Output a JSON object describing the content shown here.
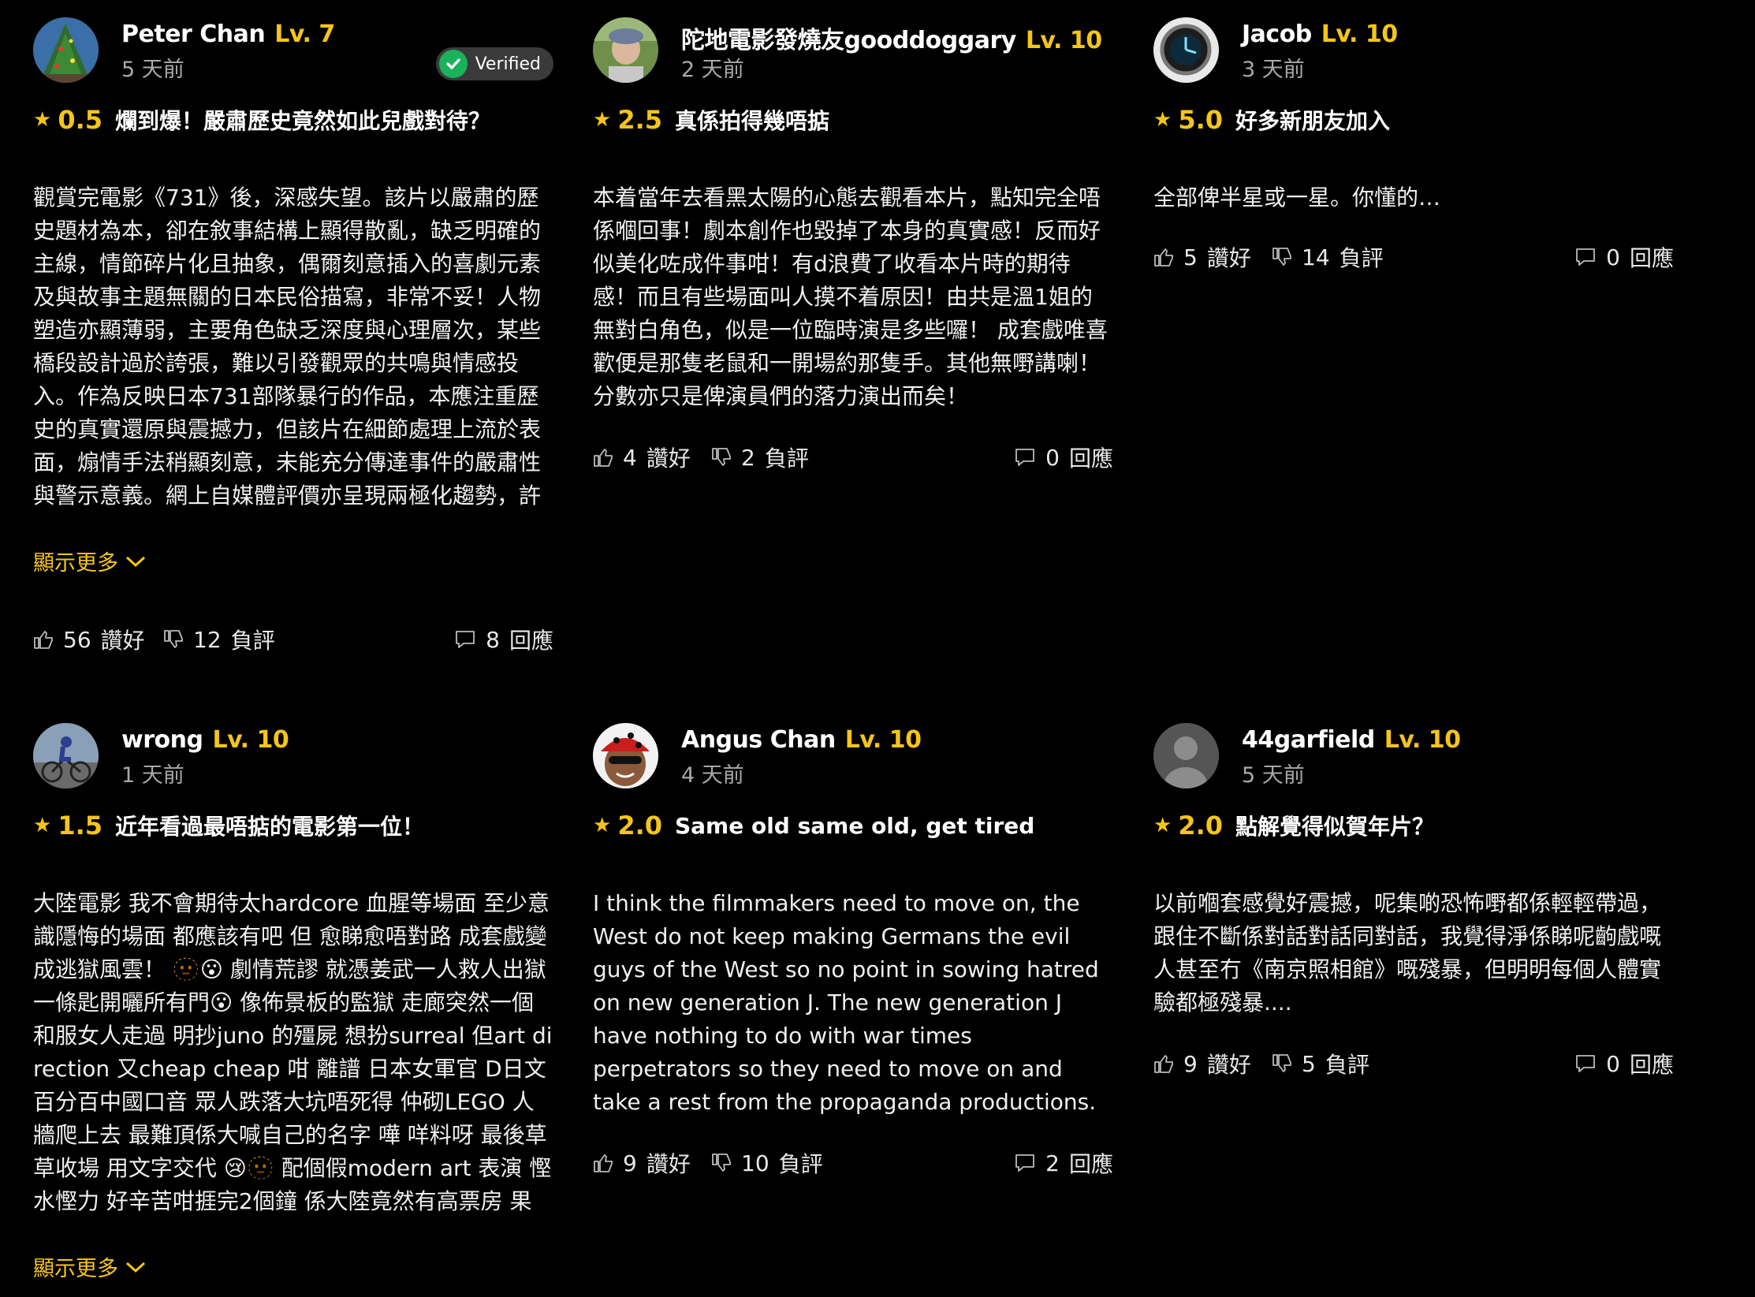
{
  "labels": {
    "show_more": "顯示更多",
    "like": "讚好",
    "dislike": "負評",
    "reply": "回應",
    "verified": "Verified"
  },
  "reviews": [
    {
      "user": "Peter Chan",
      "level": "Lv. 7",
      "time": "5 天前",
      "verified": true,
      "score": "0.5",
      "title": "爛到爆！嚴肅歷史竟然如此兒戲對待？",
      "body": "觀賞完電影《731》後，深感失望。該片以嚴肅的歷史題材為本，卻在敘事結構上顯得散亂，缺乏明確的主線，情節碎片化且抽象，偶爾刻意插入的喜劇元素及與故事主題無關的日本民俗描寫，非常不妥！人物塑造亦顯薄弱，主要角色缺乏深度與心理層次，某些橋段設計過於誇張，難以引發觀眾的共鳴與情感投入。作為反映日本731部隊暴行的作品，本應注重歷史的真實還原與震撼力，但該片在細節處理上流於表面，煽情手法稍顯刻意，未能充分傳達事件的嚴肅性與警示意義。網上自媒體評價亦呈現兩極化趨勢，許多意…",
      "likes": "56",
      "dislikes": "12",
      "replies": "8",
      "show_more": true
    },
    {
      "user": "陀地電影發燒友gooddoggary",
      "level": "Lv. 10",
      "time": "2 天前",
      "verified": false,
      "score": "2.5",
      "title": "真係拍得幾唔掂",
      "body": "本着當年去看黑太陽的心態去觀看本片，點知完全唔係嗰回事！劇本創作也毀掉了本身的真實感！反而好似美化咗成件事咁！有d浪費了收看本片時的期待感！而且有些場面叫人摸不着原因！由共是溫1姐的無對白角色，似是一位臨時演是多些囉！ 成套戲唯喜歡便是那隻老鼠和一開場約那隻手。其他無嘢講喇！分數亦只是俾演員們的落力演出而矣！",
      "likes": "4",
      "dislikes": "2",
      "replies": "0",
      "show_more": false
    },
    {
      "user": "Jacob",
      "level": "Lv. 10",
      "time": "3 天前",
      "verified": false,
      "score": "5.0",
      "title": "好多新朋友加入",
      "body": "全部俾半星或一星。你懂的…",
      "likes": "5",
      "dislikes": "14",
      "replies": "0",
      "show_more": false
    },
    {
      "user": "wrong",
      "level": "Lv. 10",
      "time": "1 天前",
      "verified": false,
      "score": "1.5",
      "title": "近年看過最唔掂的電影第一位！",
      "body": "大陸電影 我不會期待太hardcore 血腥等場面 至少意識隱悔的場面 都應該有吧 但 愈睇愈唔對路 成套戲變成逃獄風雲！ 🫥😮 劇情荒謬 就憑姜武一人救人出獄 一條匙開曬所有門😮 像佈景板的監獄 走廊突然一個和服女人走過 明抄juno 的殭屍 想扮surreal 但art direction 又cheap cheap 咁 離譜 日本女軍官 D日文 百分百中國口音 眾人跌落大坑唔死得 仲砌LEGO 人牆爬上去 最難頂係大喊自己的名字 嘩 咩料呀 最後草草收場 用文字交代 😢🫥 配個假modern art 表演 慳水慳力 好辛苦咁捱完2個鐘 係大陸竟然有高票房 果然神…",
      "likes": "",
      "dislikes": "",
      "replies": "",
      "show_more": true
    },
    {
      "user": "Angus Chan",
      "level": "Lv. 10",
      "time": "4 天前",
      "verified": false,
      "score": "2.0",
      "title": "Same old same old, get tired",
      "body": "I think the filmmakers need to move on, the West do not keep making Germans the evil guys of the West so no point in sowing hatred on new generation J. The new generation J have nothing to do with war times perpetrators so they need to move on and take a rest from the propaganda productions.",
      "likes": "9",
      "dislikes": "10",
      "replies": "2",
      "show_more": false
    },
    {
      "user": "44garfield",
      "level": "Lv. 10",
      "time": "5 天前",
      "verified": false,
      "score": "2.0",
      "title": "點解覺得似賀年片？",
      "body": "以前嗰套感覺好震撼，呢集啲恐怖嘢都係輕輕帶過，跟住不斷係對話對話同對話，我覺得淨係睇呢齣戲嘅人甚至冇《南京照相館》嘅殘暴，但明明每個人體實驗都極殘暴....",
      "likes": "9",
      "dislikes": "5",
      "replies": "0",
      "show_more": false
    }
  ],
  "colors": {
    "accent": "#f5c518",
    "background": "#000000",
    "muted": "#a9a9a9",
    "verified_check": "#19b35b"
  },
  "icons": [
    "star-icon",
    "thumbs-up-icon",
    "thumbs-down-icon",
    "comment-icon",
    "check-icon",
    "chevron-down-icon"
  ]
}
